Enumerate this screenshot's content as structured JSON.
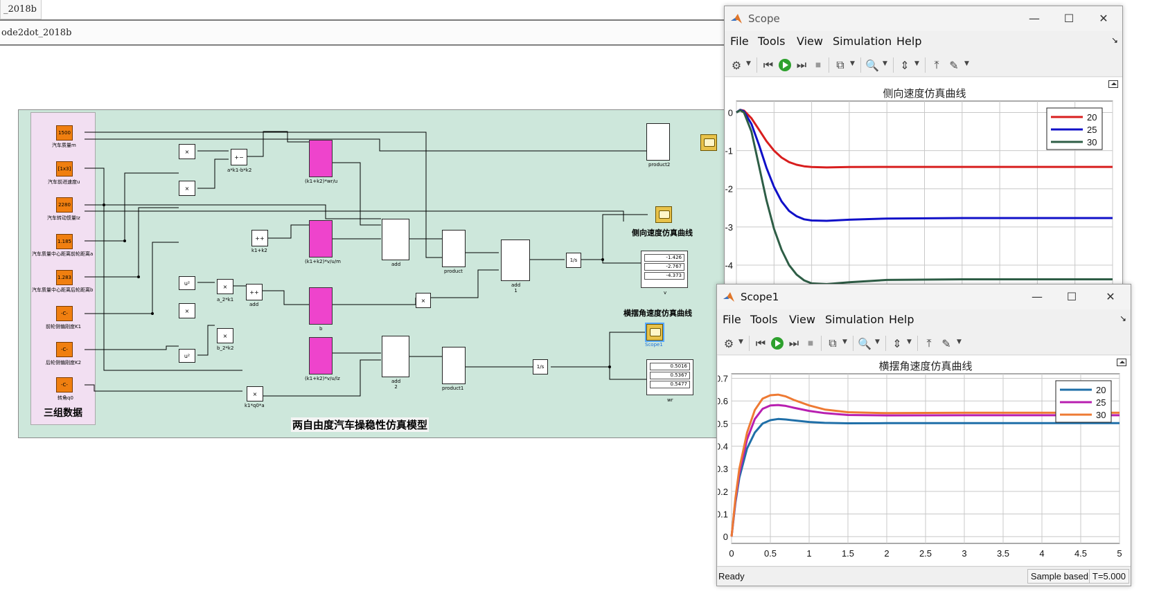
{
  "simulink": {
    "tab_label": "_2018b",
    "address_label": "ode2dot_2018b",
    "diagram_title": "两自由度汽车操稳性仿真模型",
    "group_label": "三组数据",
    "constants": [
      {
        "value": "1500",
        "label": "汽车质量m"
      },
      {
        "value": "[1x3]",
        "label": "汽车前进速度u"
      },
      {
        "value": "2280",
        "label": "汽车转动惯量Iz"
      },
      {
        "value": "1.185",
        "label": "汽车质量中心距离前轮距离a"
      },
      {
        "value": "1.283",
        "label": "汽车质量中心距离后轮距离b"
      },
      {
        "value": "-C-",
        "label": "前轮侧偏刚度K1"
      },
      {
        "value": "-C-",
        "label": "后轮侧偏刚度K2"
      },
      {
        "value": "-C-",
        "label": "转角q0"
      }
    ],
    "block_labels": {
      "ak1_bk2": "a*k1-b*k2",
      "k1k2_wr_u": "(k1+k2)*wr/u",
      "k1pk2": "k1+k2",
      "k1k2_v_u_m": "(k1+k2)*v/u/m",
      "a2k1": "a_2*k1",
      "add": "add",
      "b": "b",
      "b2k2": "b_2*k2",
      "k1k2_v_u_lz": "(k1+k2)*v/u/lz",
      "k1q0a": "k1*q0*a",
      "add_top": "add",
      "add2": "add\n2",
      "product": "product",
      "product1": "product1",
      "add1": "add\n1",
      "product2": "product2",
      "v": "v",
      "wr": "wr",
      "scope1": "Scope1"
    },
    "notes": {
      "lateral_velocity": "侧向速度仿真曲线",
      "yaw_rate": "横摆角速度仿真曲线"
    },
    "display_v": [
      "-1.426",
      "-2.767",
      "-4.373"
    ],
    "display_wr": [
      "0.5016",
      "0.5367",
      "0.5477"
    ]
  },
  "scope": {
    "title": "Scope",
    "menu": [
      "File",
      "Tools",
      "View",
      "Simulation",
      "Help"
    ],
    "chart_title": "侧向速度仿真曲线"
  },
  "scope1": {
    "title": "Scope1",
    "menu": [
      "File",
      "Tools",
      "View",
      "Simulation",
      "Help"
    ],
    "chart_title": "横摆角速度仿真曲线",
    "status": "Ready",
    "status_mode": "Sample based",
    "status_time": "T=5.000"
  },
  "colors": {
    "matlab_red": "#d81e1e",
    "matlab_blue": "#1010c8",
    "matlab_green": "#2e5e46",
    "line_20": "#1f6fa8",
    "line_25": "#b81fb0",
    "line_30": "#ee7a33",
    "constant_orange": "#f07f10",
    "magenta_block": "#ee44cc"
  },
  "chart_data": [
    {
      "type": "line",
      "title": "侧向速度仿真曲线",
      "xlabel": "",
      "ylabel": "",
      "ylim": [
        -4.6,
        0.3
      ],
      "xlim": [
        0,
        5
      ],
      "yticks": [
        0,
        -1,
        -2,
        -3,
        -4
      ],
      "grid": true,
      "legend_position": "top-right",
      "x": [
        0,
        0.05,
        0.1,
        0.2,
        0.3,
        0.4,
        0.5,
        0.6,
        0.7,
        0.8,
        0.9,
        1.0,
        1.2,
        1.5,
        2.0,
        3.0,
        4.0,
        5.0
      ],
      "series": [
        {
          "name": "20",
          "color": "#d81e1e",
          "values": [
            0,
            0.07,
            0.05,
            -0.15,
            -0.45,
            -0.75,
            -1.0,
            -1.18,
            -1.3,
            -1.37,
            -1.41,
            -1.43,
            -1.44,
            -1.43,
            -1.426,
            -1.426,
            -1.426,
            -1.426
          ]
        },
        {
          "name": "25",
          "color": "#1010c8",
          "values": [
            0,
            0.07,
            0.03,
            -0.3,
            -0.85,
            -1.45,
            -1.95,
            -2.33,
            -2.58,
            -2.72,
            -2.8,
            -2.83,
            -2.84,
            -2.81,
            -2.78,
            -2.767,
            -2.767,
            -2.767
          ]
        },
        {
          "name": "30",
          "color": "#2e5e46",
          "values": [
            0,
            0.06,
            0.0,
            -0.5,
            -1.4,
            -2.3,
            -3.05,
            -3.6,
            -4.0,
            -4.25,
            -4.4,
            -4.48,
            -4.5,
            -4.45,
            -4.39,
            -4.373,
            -4.373,
            -4.373
          ]
        }
      ]
    },
    {
      "type": "line",
      "title": "横摆角速度仿真曲线",
      "xlabel": "",
      "ylabel": "",
      "ylim": [
        -0.03,
        0.72
      ],
      "xlim": [
        0,
        5
      ],
      "xticks": [
        0,
        0.5,
        1,
        1.5,
        2,
        2.5,
        3,
        3.5,
        4,
        4.5,
        5
      ],
      "yticks": [
        0,
        0.1,
        0.2,
        0.3,
        0.4,
        0.5,
        0.6,
        0.7
      ],
      "grid": true,
      "legend_position": "top-right",
      "x": [
        0,
        0.05,
        0.1,
        0.2,
        0.3,
        0.4,
        0.5,
        0.6,
        0.7,
        0.8,
        1.0,
        1.2,
        1.5,
        2.0,
        3.0,
        4.0,
        5.0
      ],
      "series": [
        {
          "name": "20",
          "color": "#1f6fa8",
          "values": [
            0,
            0.15,
            0.26,
            0.39,
            0.46,
            0.5,
            0.515,
            0.52,
            0.518,
            0.514,
            0.507,
            0.503,
            0.501,
            0.5016,
            0.5016,
            0.5016,
            0.5016
          ]
        },
        {
          "name": "25",
          "color": "#b81fb0",
          "values": [
            0,
            0.16,
            0.28,
            0.43,
            0.52,
            0.565,
            0.58,
            0.582,
            0.578,
            0.57,
            0.556,
            0.546,
            0.538,
            0.536,
            0.5367,
            0.5367,
            0.5367
          ]
        },
        {
          "name": "30",
          "color": "#ee7a33",
          "values": [
            0,
            0.17,
            0.3,
            0.46,
            0.56,
            0.61,
            0.625,
            0.628,
            0.62,
            0.605,
            0.58,
            0.562,
            0.55,
            0.546,
            0.5477,
            0.5477,
            0.5477
          ]
        }
      ]
    }
  ]
}
